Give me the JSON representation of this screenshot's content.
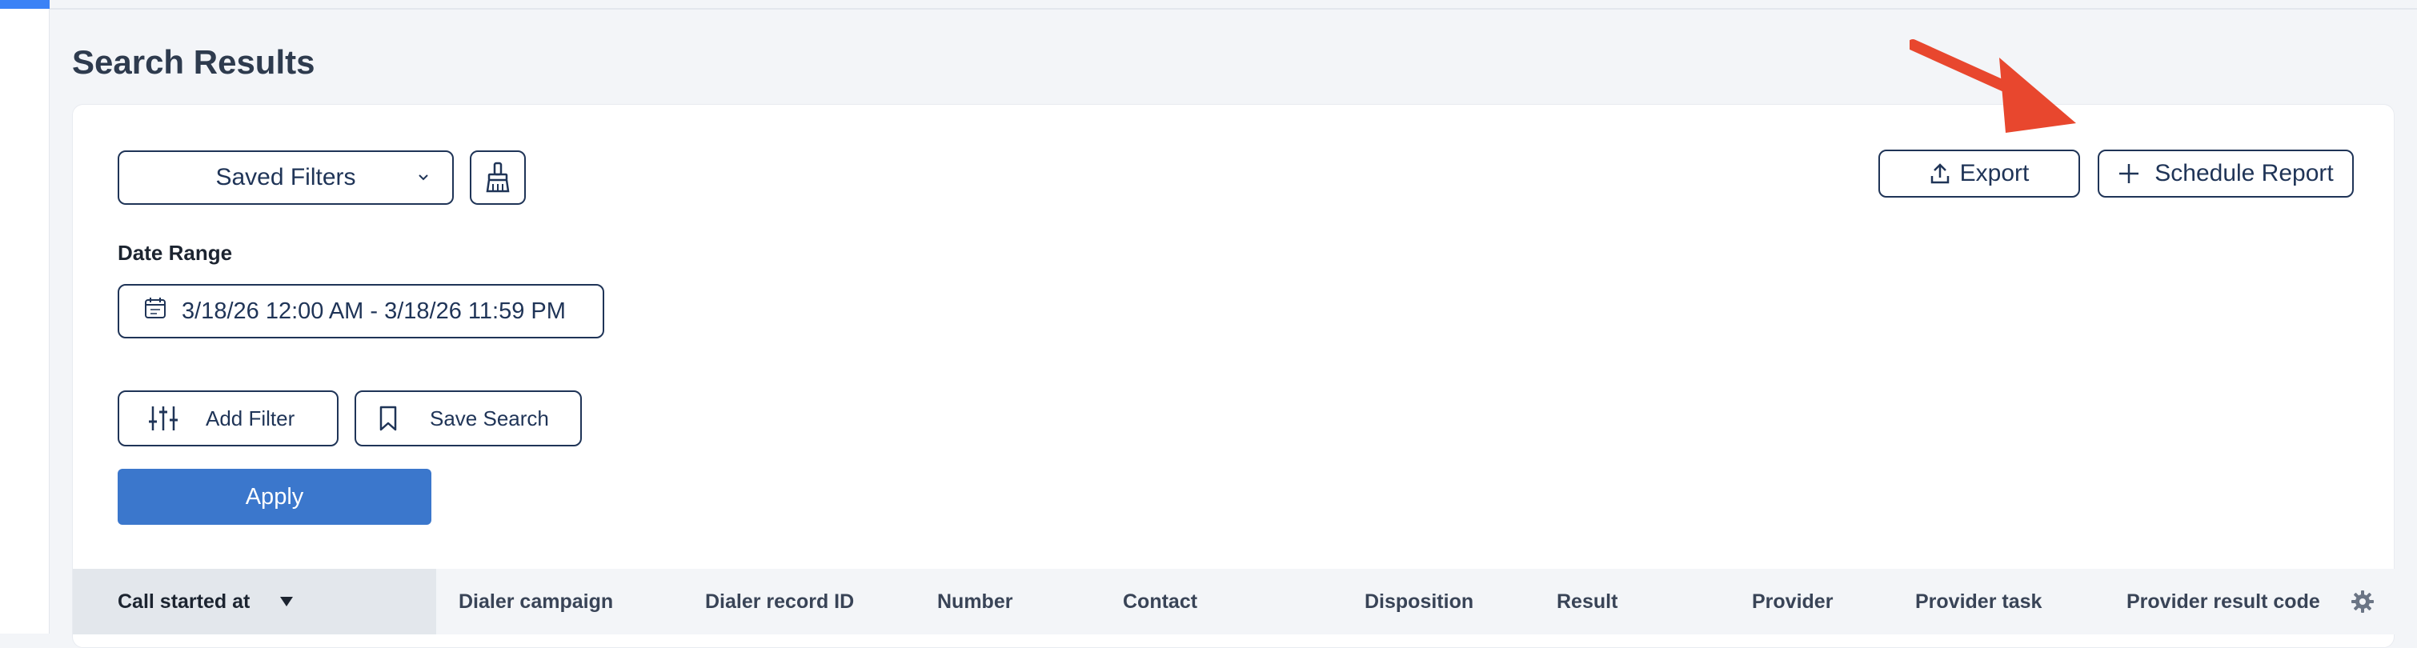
{
  "page": {
    "title": "Search Results"
  },
  "toolbar": {
    "saved_filters_label": "Saved Filters",
    "export_label": "Export",
    "schedule_report_label": "Schedule Report"
  },
  "date_range": {
    "label": "Date Range",
    "value": "3/18/26 12:00 AM - 3/18/26 11:59 PM"
  },
  "actions": {
    "add_filter_label": "Add Filter",
    "save_search_label": "Save Search",
    "apply_label": "Apply"
  },
  "table": {
    "columns": [
      "Call started at",
      "Dialer campaign",
      "Dialer record ID",
      "Number",
      "Contact",
      "Disposition",
      "Result",
      "Provider",
      "Provider task",
      "Provider result code"
    ],
    "sort_direction_icon": "caret-down-icon"
  },
  "colors": {
    "primary": "#1f3457",
    "accent_blue": "#3b77cc",
    "rail_accent": "#3b82f6",
    "annotation_arrow": "#e8472e"
  },
  "icons": {
    "saved_filters": "chevron-down-icon",
    "clear_filters": "broom-icon",
    "export": "upload-icon",
    "schedule_report": "plus-icon",
    "date_range": "calendar-icon",
    "add_filter": "sliders-icon",
    "save_search": "bookmark-icon",
    "table_settings": "gear-icon"
  }
}
